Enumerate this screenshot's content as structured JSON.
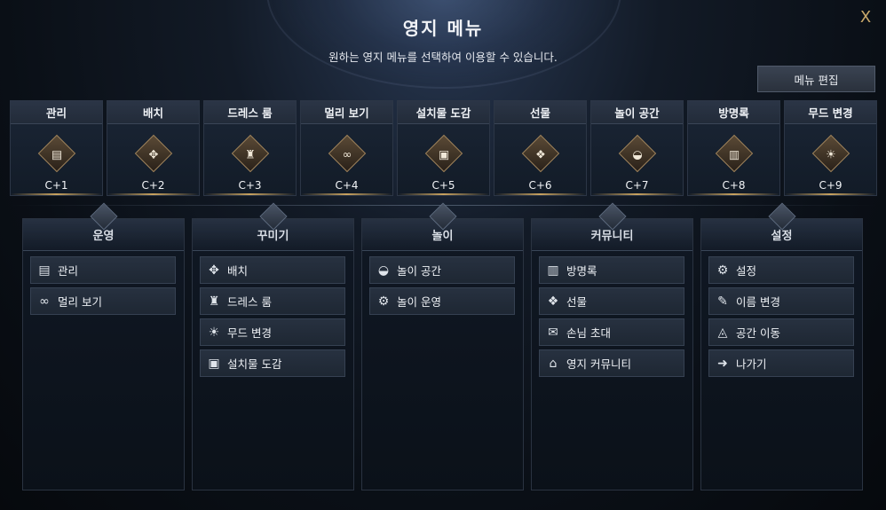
{
  "header": {
    "title": "영지 메뉴",
    "subtitle": "원하는 영지 메뉴를 선택하여 이용할 수 있습니다.",
    "close_glyph": "X",
    "edit_label": "메뉴 편집"
  },
  "cards": [
    {
      "label": "관리",
      "key": "C+1",
      "icon": "clipboard-icon",
      "glyph": "▤"
    },
    {
      "label": "배치",
      "key": "C+2",
      "icon": "move-arrows-icon",
      "glyph": "✥"
    },
    {
      "label": "드레스 룸",
      "key": "C+3",
      "icon": "jacket-icon",
      "glyph": "♜"
    },
    {
      "label": "멀리 보기",
      "key": "C+4",
      "icon": "binoculars-icon",
      "glyph": "∞"
    },
    {
      "label": "설치물 도감",
      "key": "C+5",
      "icon": "catalog-icon",
      "glyph": "▣"
    },
    {
      "label": "선물",
      "key": "C+6",
      "icon": "gift-icon",
      "glyph": "❖"
    },
    {
      "label": "놀이 공간",
      "key": "C+7",
      "icon": "gamepad-icon",
      "glyph": "◒"
    },
    {
      "label": "방명록",
      "key": "C+8",
      "icon": "guestbook-icon",
      "glyph": "▥"
    },
    {
      "label": "무드 변경",
      "key": "C+9",
      "icon": "weather-icon",
      "glyph": "☀"
    }
  ],
  "panels": [
    {
      "title": "운영",
      "items": [
        {
          "label": "관리",
          "icon": "clipboard-icon",
          "glyph": "▤"
        },
        {
          "label": "멀리 보기",
          "icon": "binoculars-icon",
          "glyph": "∞"
        }
      ]
    },
    {
      "title": "꾸미기",
      "items": [
        {
          "label": "배치",
          "icon": "move-arrows-icon",
          "glyph": "✥"
        },
        {
          "label": "드레스 룸",
          "icon": "jacket-icon",
          "glyph": "♜"
        },
        {
          "label": "무드 변경",
          "icon": "weather-icon",
          "glyph": "☀"
        },
        {
          "label": "설치물 도감",
          "icon": "catalog-icon",
          "glyph": "▣"
        }
      ]
    },
    {
      "title": "놀이",
      "items": [
        {
          "label": "놀이 공간",
          "icon": "gamepad-icon",
          "glyph": "◒"
        },
        {
          "label": "놀이 운영",
          "icon": "gear-person-icon",
          "glyph": "⚙"
        }
      ]
    },
    {
      "title": "커뮤니티",
      "items": [
        {
          "label": "방명록",
          "icon": "guestbook-icon",
          "glyph": "▥"
        },
        {
          "label": "선물",
          "icon": "gift-icon",
          "glyph": "❖"
        },
        {
          "label": "손님 초대",
          "icon": "invite-icon",
          "glyph": "✉"
        },
        {
          "label": "영지 커뮤니티",
          "icon": "home-icon",
          "glyph": "⌂"
        }
      ]
    },
    {
      "title": "설정",
      "items": [
        {
          "label": "설정",
          "icon": "gear-icon",
          "glyph": "⚙"
        },
        {
          "label": "이름 변경",
          "icon": "edit-icon",
          "glyph": "✎"
        },
        {
          "label": "공간 이동",
          "icon": "teleport-icon",
          "glyph": "◬"
        },
        {
          "label": "나가기",
          "icon": "exit-icon",
          "glyph": "➜"
        }
      ]
    }
  ]
}
